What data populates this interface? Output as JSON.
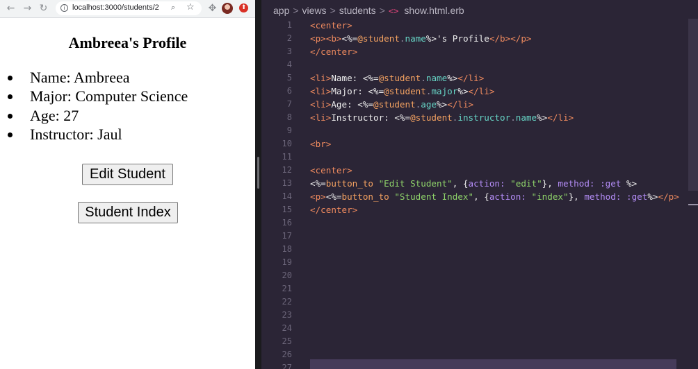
{
  "browser": {
    "url": "localhost:3000/students/2",
    "nav": {
      "back": "←",
      "forward": "→",
      "reload": "↻"
    },
    "icons": {
      "info": "i",
      "zoom": "⌕",
      "bookmark": "☆",
      "extensions": "✥",
      "update": "⬆"
    }
  },
  "page": {
    "title": "Ambreea's Profile",
    "details": [
      "Name: Ambreea",
      "Major: Computer Science",
      "Age: 27",
      "Instructor: Jaul"
    ],
    "buttons": {
      "edit": "Edit Student",
      "index": "Student Index"
    }
  },
  "editor": {
    "breadcrumb": [
      "app",
      "views",
      "students"
    ],
    "breadcrumb_sep": ">",
    "file_icon": "<>",
    "file": "show.html.erb",
    "line_numbers": [
      "1",
      "2",
      "3",
      "4",
      "5",
      "6",
      "7",
      "8",
      "9",
      "10",
      "11",
      "12",
      "13",
      "14",
      "15",
      "16",
      "17",
      "18",
      "19",
      "20",
      "21",
      "22",
      "23",
      "24",
      "25",
      "26",
      "27"
    ],
    "code_lines": [
      [
        {
          "t": "<center>",
          "c": "tg"
        }
      ],
      [
        {
          "t": "<p><b>",
          "c": "tg"
        },
        {
          "t": "<%=",
          "c": "wt"
        },
        {
          "t": "@student",
          "c": "fn"
        },
        {
          "t": ".",
          "c": "br"
        },
        {
          "t": "name",
          "c": "iv"
        },
        {
          "t": "%>",
          "c": "wt"
        },
        {
          "t": "'s Profile",
          "c": "wt"
        },
        {
          "t": "</b></p>",
          "c": "tg"
        }
      ],
      [
        {
          "t": "</center>",
          "c": "tg"
        }
      ],
      [],
      [
        {
          "t": "<li>",
          "c": "tg"
        },
        {
          "t": "Name: ",
          "c": "wt"
        },
        {
          "t": "<%=",
          "c": "wt"
        },
        {
          "t": "@student",
          "c": "fn"
        },
        {
          "t": ".",
          "c": "br"
        },
        {
          "t": "name",
          "c": "iv"
        },
        {
          "t": "%>",
          "c": "wt"
        },
        {
          "t": "</li>",
          "c": "tg"
        }
      ],
      [
        {
          "t": "<li>",
          "c": "tg"
        },
        {
          "t": "Major: ",
          "c": "wt"
        },
        {
          "t": "<%=",
          "c": "wt"
        },
        {
          "t": "@student",
          "c": "fn"
        },
        {
          "t": ".",
          "c": "br"
        },
        {
          "t": "major",
          "c": "iv"
        },
        {
          "t": "%>",
          "c": "wt"
        },
        {
          "t": "</li>",
          "c": "tg"
        }
      ],
      [
        {
          "t": "<li>",
          "c": "tg"
        },
        {
          "t": "Age: ",
          "c": "wt"
        },
        {
          "t": "<%=",
          "c": "wt"
        },
        {
          "t": "@student",
          "c": "fn"
        },
        {
          "t": ".",
          "c": "br"
        },
        {
          "t": "age",
          "c": "iv"
        },
        {
          "t": "%>",
          "c": "wt"
        },
        {
          "t": "</li>",
          "c": "tg"
        }
      ],
      [
        {
          "t": "<li>",
          "c": "tg"
        },
        {
          "t": "Instructor: ",
          "c": "wt"
        },
        {
          "t": "<%=",
          "c": "wt"
        },
        {
          "t": "@student",
          "c": "fn"
        },
        {
          "t": ".",
          "c": "br"
        },
        {
          "t": "instructor",
          "c": "iv"
        },
        {
          "t": ".",
          "c": "br"
        },
        {
          "t": "name",
          "c": "iv"
        },
        {
          "t": "%>",
          "c": "wt"
        },
        {
          "t": "</li>",
          "c": "tg"
        }
      ],
      [],
      [
        {
          "t": "<br>",
          "c": "tg"
        }
      ],
      [],
      [
        {
          "t": "<center>",
          "c": "tg"
        }
      ],
      [
        {
          "t": "<%=",
          "c": "wt"
        },
        {
          "t": "button_to",
          "c": "fn"
        },
        {
          "t": " ",
          "c": "wt"
        },
        {
          "t": "\"Edit Student\"",
          "c": "st"
        },
        {
          "t": ", {",
          "c": "wt"
        },
        {
          "t": "action:",
          "c": "kw"
        },
        {
          "t": " ",
          "c": "wt"
        },
        {
          "t": "\"edit\"",
          "c": "st"
        },
        {
          "t": "}, ",
          "c": "wt"
        },
        {
          "t": "method:",
          "c": "kw"
        },
        {
          "t": " ",
          "c": "wt"
        },
        {
          "t": ":get",
          "c": "kw"
        },
        {
          "t": " %>",
          "c": "wt"
        }
      ],
      [
        {
          "t": "<p>",
          "c": "tg"
        },
        {
          "t": "<%=",
          "c": "wt"
        },
        {
          "t": "button_to",
          "c": "fn"
        },
        {
          "t": " ",
          "c": "wt"
        },
        {
          "t": "\"Student Index\"",
          "c": "st"
        },
        {
          "t": ", {",
          "c": "wt"
        },
        {
          "t": "action:",
          "c": "kw"
        },
        {
          "t": " ",
          "c": "wt"
        },
        {
          "t": "\"index\"",
          "c": "st"
        },
        {
          "t": "}, ",
          "c": "wt"
        },
        {
          "t": "method:",
          "c": "kw"
        },
        {
          "t": " ",
          "c": "wt"
        },
        {
          "t": ":get",
          "c": "kw"
        },
        {
          "t": "%>",
          "c": "wt"
        },
        {
          "t": "</p>",
          "c": "tg"
        }
      ],
      [
        {
          "t": "</center>",
          "c": "tg"
        }
      ]
    ]
  }
}
